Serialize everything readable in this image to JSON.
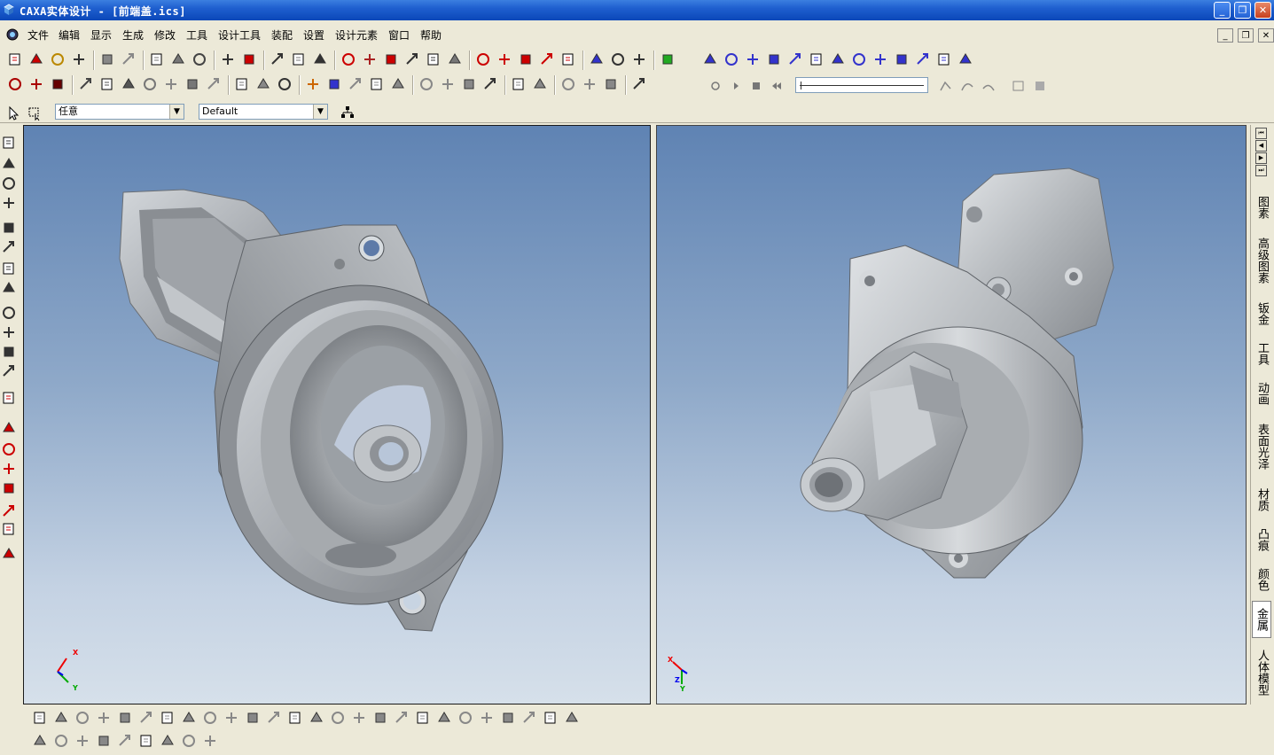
{
  "window": {
    "title": "CAXA实体设计 - [前端盖.ics]",
    "minimize_glyph": "_",
    "restore_glyph": "❐",
    "close_glyph": "✕"
  },
  "menu": {
    "items": [
      "文件",
      "编辑",
      "显示",
      "生成",
      "修改",
      "工具",
      "设计工具",
      "装配",
      "设置",
      "设计元素",
      "窗口",
      "帮助"
    ]
  },
  "selectors": {
    "filter_value": "任意",
    "style_value": "Default"
  },
  "viewports": {
    "left": {
      "axis_x": "X",
      "axis_y": "Y"
    },
    "right": {
      "axis_x": "X",
      "axis_y": "Y",
      "axis_z": "Z"
    }
  },
  "design_library_tabs": [
    {
      "label": "图素",
      "active": false
    },
    {
      "label": "高级图素",
      "active": false
    },
    {
      "label": "钣金",
      "active": false
    },
    {
      "label": "工具",
      "active": false
    },
    {
      "label": "动画",
      "active": false
    },
    {
      "label": "表面光泽",
      "active": false
    },
    {
      "label": "材质",
      "active": false
    },
    {
      "label": "凸痕",
      "active": false
    },
    {
      "label": "颜色",
      "active": false
    },
    {
      "label": "金属",
      "active": true
    },
    {
      "label": "人体模型",
      "active": false
    }
  ],
  "colors": {
    "titlebar": "#0a47b8",
    "chrome": "#ece9d8",
    "viewport_top": "#5f83b3",
    "viewport_bottom": "#d6e0ea",
    "part_metal": "#b4b8bc"
  },
  "icons": {
    "toolbar_row1": [
      "new-icon",
      "new-design-icon",
      "open-icon",
      "save-icon",
      "undo-icon",
      "redo-icon",
      "rotate-icon",
      "pan-icon",
      "orbit-icon",
      "find-icon",
      "help-icon",
      "render-icon",
      "light-icon",
      "camera-icon",
      "extrude-icon",
      "spin-icon",
      "sweep-icon",
      "loft-icon",
      "text-icon",
      "section-icon",
      "move-icon",
      "face-icon",
      "point-icon",
      "edge-icon",
      "hole-icon",
      "split-icon",
      "cut-icon",
      "shell-icon",
      "view-icon"
    ],
    "toolbar_row2": [
      "fill-icon",
      "fill-red-icon",
      "fill-solid-icon",
      "block-icon",
      "stair-icon",
      "stack-icon",
      "sheet-icon",
      "gear-icon",
      "box-icon",
      "layer-icon",
      "tool-icon",
      "cube-icon",
      "copy-icon",
      "pen-icon",
      "eyedrop-icon",
      "brush-icon",
      "spray-icon",
      "drop-icon",
      "frame-icon",
      "frame2-icon",
      "frame3-icon",
      "corner-icon",
      "plus-icon",
      "part-icon",
      "flag-icon",
      "flag2-icon",
      "flag3-icon",
      "wrench-icon"
    ],
    "animation_controls": [
      "record-icon",
      "play-icon",
      "stop-icon",
      "rewind-icon"
    ]
  }
}
